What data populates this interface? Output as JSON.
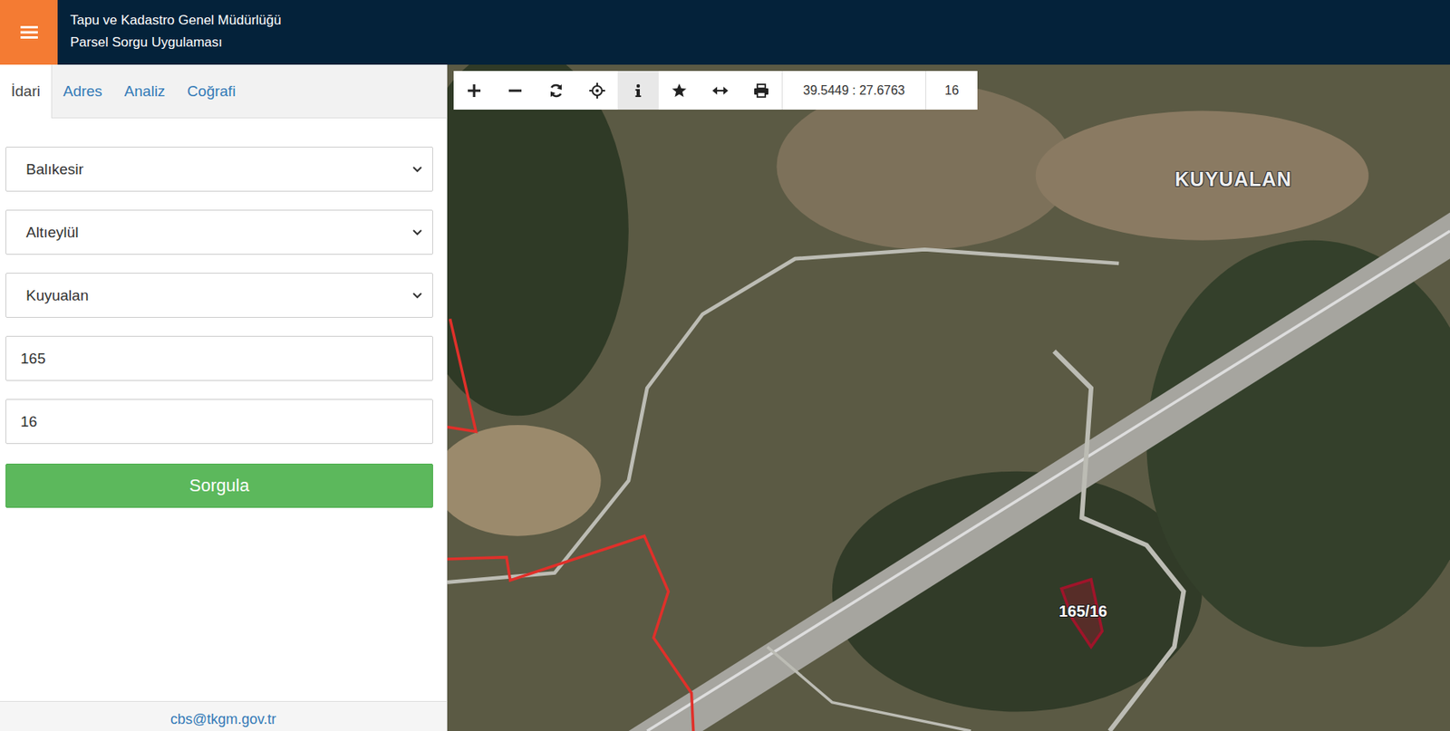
{
  "header": {
    "title": "Tapu ve Kadastro Genel Müdürlüğü",
    "subtitle": "Parsel Sorgu Uygulaması"
  },
  "tabs": [
    {
      "label": "İdari",
      "selected": true
    },
    {
      "label": "Adres",
      "selected": false
    },
    {
      "label": "Analiz",
      "selected": false
    },
    {
      "label": "Coğrafi",
      "selected": false
    }
  ],
  "form": {
    "selects": [
      "Balıkesir",
      "Altıeylül",
      "Kuyualan"
    ],
    "inputs": [
      "165",
      "16"
    ],
    "button": "Sorgula"
  },
  "footer": {
    "email": "cbs@tkgm.gov.tr"
  },
  "toolbar": {
    "coordinates": "39.5449 : 27.6763",
    "zoom": "16",
    "active_tool": "info"
  },
  "map": {
    "labels": [
      {
        "text": "KUYUALAN",
        "kind": "place"
      },
      {
        "text": "165/16",
        "kind": "parcel"
      }
    ]
  }
}
